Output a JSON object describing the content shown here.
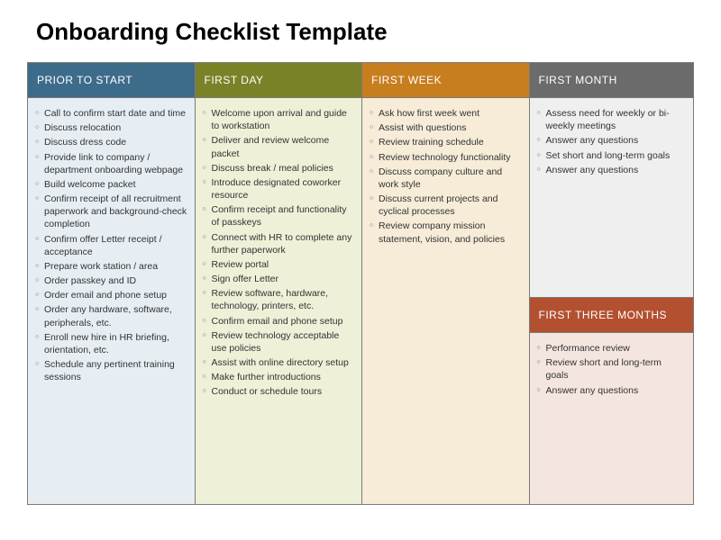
{
  "title": "Onboarding Checklist Template",
  "columns": {
    "prior": {
      "header": "PRIOR TO START",
      "items": [
        "Call to confirm start date and time",
        "Discuss relocation",
        "Discuss dress code",
        "Provide link to company / department onboarding webpage",
        "Build welcome packet",
        "Confirm receipt of all recruitment paperwork and background-check completion",
        "Confirm offer Letter receipt / acceptance",
        "Prepare work station / area",
        "Order passkey and ID",
        "Order email and phone setup",
        "Order any hardware, software, peripherals, etc.",
        "Enroll new hire in HR briefing, orientation, etc.",
        "Schedule any pertinent training sessions"
      ]
    },
    "firstDay": {
      "header": "FIRST DAY",
      "items": [
        "Welcome upon arrival and guide to workstation",
        "Deliver and review welcome packet",
        "Discuss break / meal policies",
        "Introduce designated coworker resource",
        "Confirm receipt and functionality of passkeys",
        "Connect with HR to complete any further paperwork",
        "Review portal",
        "Sign offer Letter",
        "Review software, hardware, technology, printers, etc.",
        "Confirm email and phone setup",
        "Review technology acceptable use policies",
        "Assist with online directory setup",
        "Make further introductions",
        "Conduct or schedule tours"
      ]
    },
    "firstWeek": {
      "header": "FIRST WEEK",
      "items": [
        "Ask how first week went",
        "Assist with questions",
        "Review training schedule",
        "Review technology functionality",
        "Discuss company culture and work style",
        "Discuss current projects and cyclical processes",
        "Review company mission statement, vision, and policies"
      ]
    },
    "firstMonth": {
      "header": "FIRST MONTH",
      "items": [
        "Assess need for weekly or bi-weekly meetings",
        "Answer any questions",
        "Set short and long-term goals",
        "Answer any questions"
      ]
    },
    "firstThreeMonths": {
      "header": "FIRST THREE MONTHS",
      "items": [
        "Performance review",
        "Review short and long-term goals",
        "Answer any questions"
      ]
    }
  }
}
